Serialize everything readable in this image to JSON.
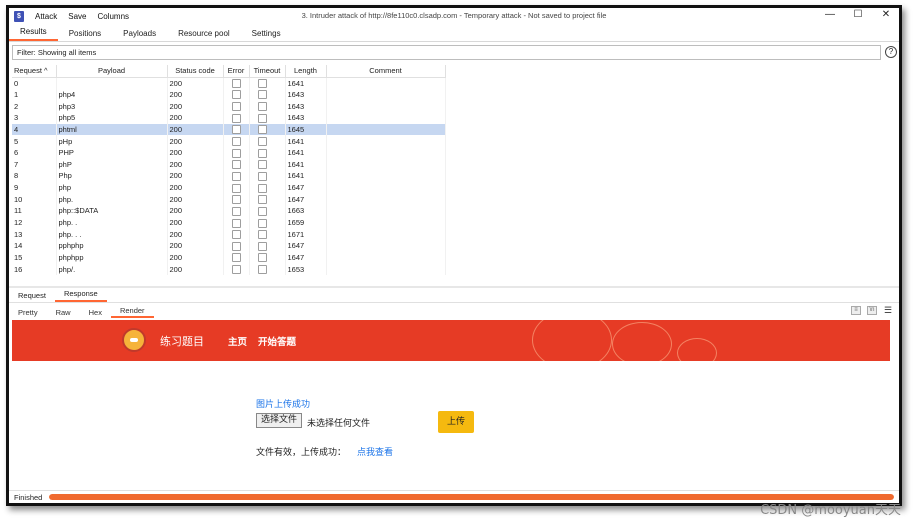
{
  "app": {
    "menu": [
      "Attack",
      "Save",
      "Columns"
    ],
    "window_title": "3. Intruder attack of http://8fe110c0.clsadp.com - Temporary attack - Not saved to project file",
    "controls": {
      "minimize": "—",
      "maximize": "☐",
      "close": "✕"
    }
  },
  "tabs": [
    "Results",
    "Positions",
    "Payloads",
    "Resource pool",
    "Settings"
  ],
  "active_tab": "Results",
  "filter": {
    "label": "Filter: Showing all items"
  },
  "table": {
    "columns": [
      "Request",
      "Payload",
      "Status code",
      "Error",
      "Timeout",
      "Length",
      "Comment"
    ],
    "sort_indicator": "^",
    "selected_row": 4,
    "rows": [
      {
        "request": "0",
        "payload": "",
        "status": "200",
        "length": "1641"
      },
      {
        "request": "1",
        "payload": "php4",
        "status": "200",
        "length": "1643"
      },
      {
        "request": "2",
        "payload": "php3",
        "status": "200",
        "length": "1643"
      },
      {
        "request": "3",
        "payload": "php5",
        "status": "200",
        "length": "1643"
      },
      {
        "request": "4",
        "payload": "phtml",
        "status": "200",
        "length": "1645"
      },
      {
        "request": "5",
        "payload": "pHp",
        "status": "200",
        "length": "1641"
      },
      {
        "request": "6",
        "payload": "PHP",
        "status": "200",
        "length": "1641"
      },
      {
        "request": "7",
        "payload": "phP",
        "status": "200",
        "length": "1641"
      },
      {
        "request": "8",
        "payload": "Php",
        "status": "200",
        "length": "1641"
      },
      {
        "request": "9",
        "payload": "php",
        "status": "200",
        "length": "1647"
      },
      {
        "request": "10",
        "payload": "php.",
        "status": "200",
        "length": "1647"
      },
      {
        "request": "11",
        "payload": "php::$DATA",
        "status": "200",
        "length": "1663"
      },
      {
        "request": "12",
        "payload": "php. .",
        "status": "200",
        "length": "1659"
      },
      {
        "request": "13",
        "payload": "php. . .",
        "status": "200",
        "length": "1671"
      },
      {
        "request": "14",
        "payload": "pphphp",
        "status": "200",
        "length": "1647"
      },
      {
        "request": "15",
        "payload": "phphpp",
        "status": "200",
        "length": "1647"
      },
      {
        "request": "16",
        "payload": "php/.",
        "status": "200",
        "length": "1653"
      }
    ]
  },
  "message_tabs": [
    "Request",
    "Response"
  ],
  "active_message_tab": "Response",
  "view_tabs": [
    "Pretty",
    "Raw",
    "Hex",
    "Render"
  ],
  "active_view_tab": "Render",
  "render": {
    "brand": "练习题目",
    "nav": [
      "主页",
      "开始答题"
    ],
    "upload_status": "图片上传成功",
    "file_button": "选择文件",
    "file_none": "未选择任何文件",
    "upload_button": "上传",
    "result_text": "文件有效，上传成功：",
    "view_link": "点我查看",
    "banner_color": "#e63b25",
    "upload_button_color": "#f5b90f"
  },
  "status": {
    "text": "Finished",
    "progress": 1.0,
    "progress_color": "#f06a2f"
  },
  "watermark": "CSDN @mooyuan天天",
  "accent_color": "#ff6633",
  "selected_row_color": "#c6d7f1"
}
